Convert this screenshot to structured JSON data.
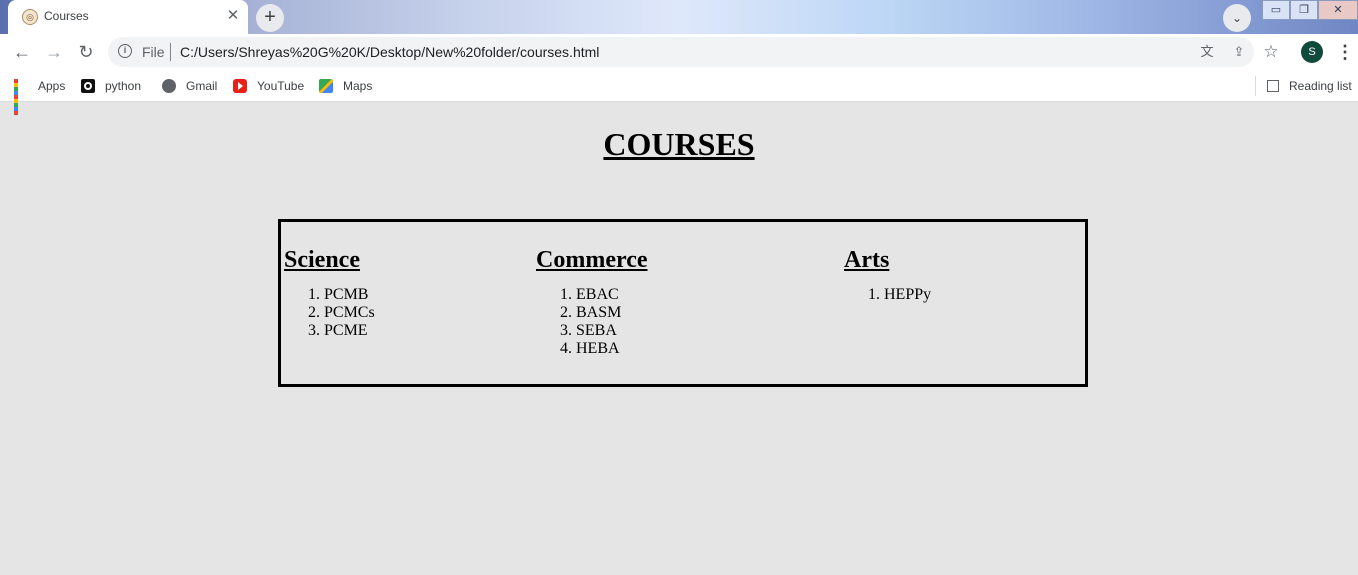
{
  "browser": {
    "tab_title": "Courses",
    "tab_close": "✕",
    "new_tab": "+",
    "tab_search": "⌄",
    "window_controls": [
      "▭",
      "❐",
      "✕"
    ],
    "address": {
      "scheme_label": "File",
      "url": "C:/Users/Shreyas%20G%20K/Desktop/New%20folder/courses.html"
    },
    "profile_initial": "S",
    "bookmarks": [
      {
        "label": "Apps",
        "icon": "apps-grid-icon"
      },
      {
        "label": "python",
        "icon": "python-icon"
      },
      {
        "label": "Gmail",
        "icon": "globe-icon"
      },
      {
        "label": "YouTube",
        "icon": "youtube-icon"
      },
      {
        "label": "Maps",
        "icon": "maps-icon"
      }
    ],
    "reading_list": "Reading list"
  },
  "page": {
    "title": "COURSES",
    "columns": [
      {
        "heading": "Science",
        "items": [
          "PCMB",
          "PCMCs",
          "PCME"
        ]
      },
      {
        "heading": "Commerce",
        "items": [
          "EBAC",
          "BASM",
          "SEBA",
          "HEBA"
        ]
      },
      {
        "heading": "Arts",
        "items": [
          "HEPPy"
        ]
      }
    ]
  },
  "colors": {
    "page_background": "#e5e5e5",
    "avatar": "#0f4a3a",
    "youtube_red": "#e62117"
  }
}
